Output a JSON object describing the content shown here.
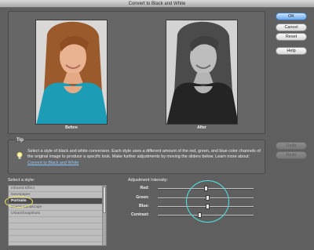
{
  "window": {
    "title": "Convert to Black and White"
  },
  "preview": {
    "before_label": "Before",
    "after_label": "After"
  },
  "buttons": {
    "ok": "OK",
    "cancel": "Cancel",
    "reset": "Reset",
    "help": "Help",
    "undo": "Undo",
    "redo": "Redo"
  },
  "tip": {
    "label": "Tip",
    "text": "Select a style of black and white conversion. Each style uses a different amount of the red, green, and blue color channels of the original image to produce a specific look. Make further adjustments by moving the sliders below. Learn more about:",
    "link": "Convert to Black and White"
  },
  "styles": {
    "label": "Select a style:",
    "items": [
      "Infrared Effect",
      "Newspaper",
      "Portraits",
      "Scenic Landscape",
      "Urban/Snapshots",
      "",
      "",
      "",
      ""
    ],
    "selected_index": 2
  },
  "adjustment": {
    "label": "Adjustment Intensity:",
    "sliders": [
      {
        "name": "Red:",
        "value": 0.5
      },
      {
        "name": "Green:",
        "value": 0.52
      },
      {
        "name": "Blue:",
        "value": 0.52
      },
      {
        "name": "Contrast:",
        "value": 0.44
      }
    ]
  },
  "colors": {
    "annotation_yellow": "#f3e65d",
    "annotation_cyan": "#4ee6e0"
  }
}
